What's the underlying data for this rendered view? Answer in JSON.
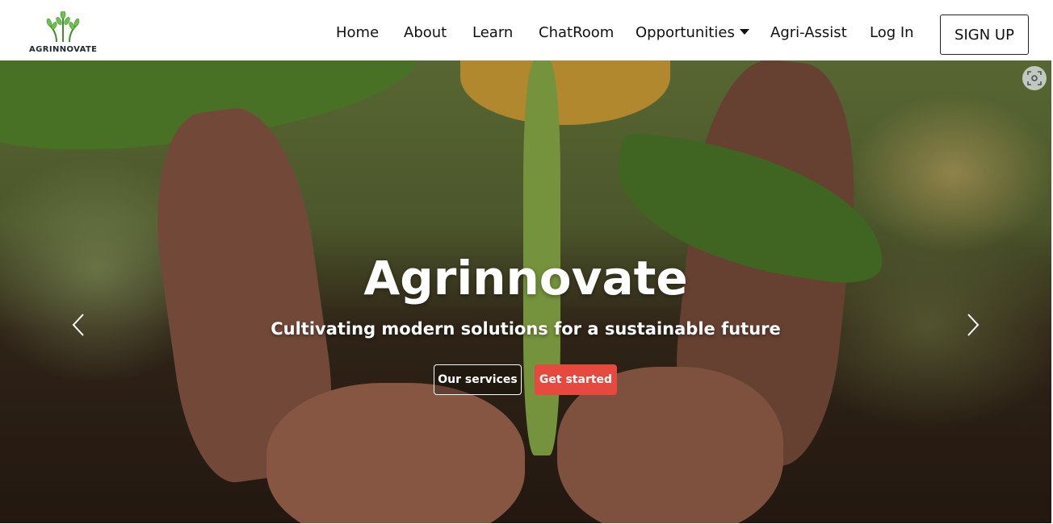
{
  "brand": {
    "name": "AGRINNOVATE",
    "logo_icon": "wheat-sprouts-icon",
    "logo_color": "#6cc24a"
  },
  "nav": {
    "items": [
      {
        "label": "Home"
      },
      {
        "label": "About"
      },
      {
        "label": "Learn"
      },
      {
        "label": "ChatRoom"
      },
      {
        "label": "Opportunities",
        "icon": "caret-down-icon"
      },
      {
        "label": "Agri-Assist"
      },
      {
        "label": "Log In"
      }
    ],
    "signup_label": "SIGN UP"
  },
  "hero": {
    "title": "Agrinnovate",
    "subtitle": "Cultivating modern solutions for a sustainable future",
    "primary_button": "Our services",
    "secondary_button": "Get started",
    "accent_color": "#e8493f",
    "prev_icon": "chevron-left-icon",
    "next_icon": "chevron-right-icon",
    "lens_icon": "visual-search-icon"
  }
}
